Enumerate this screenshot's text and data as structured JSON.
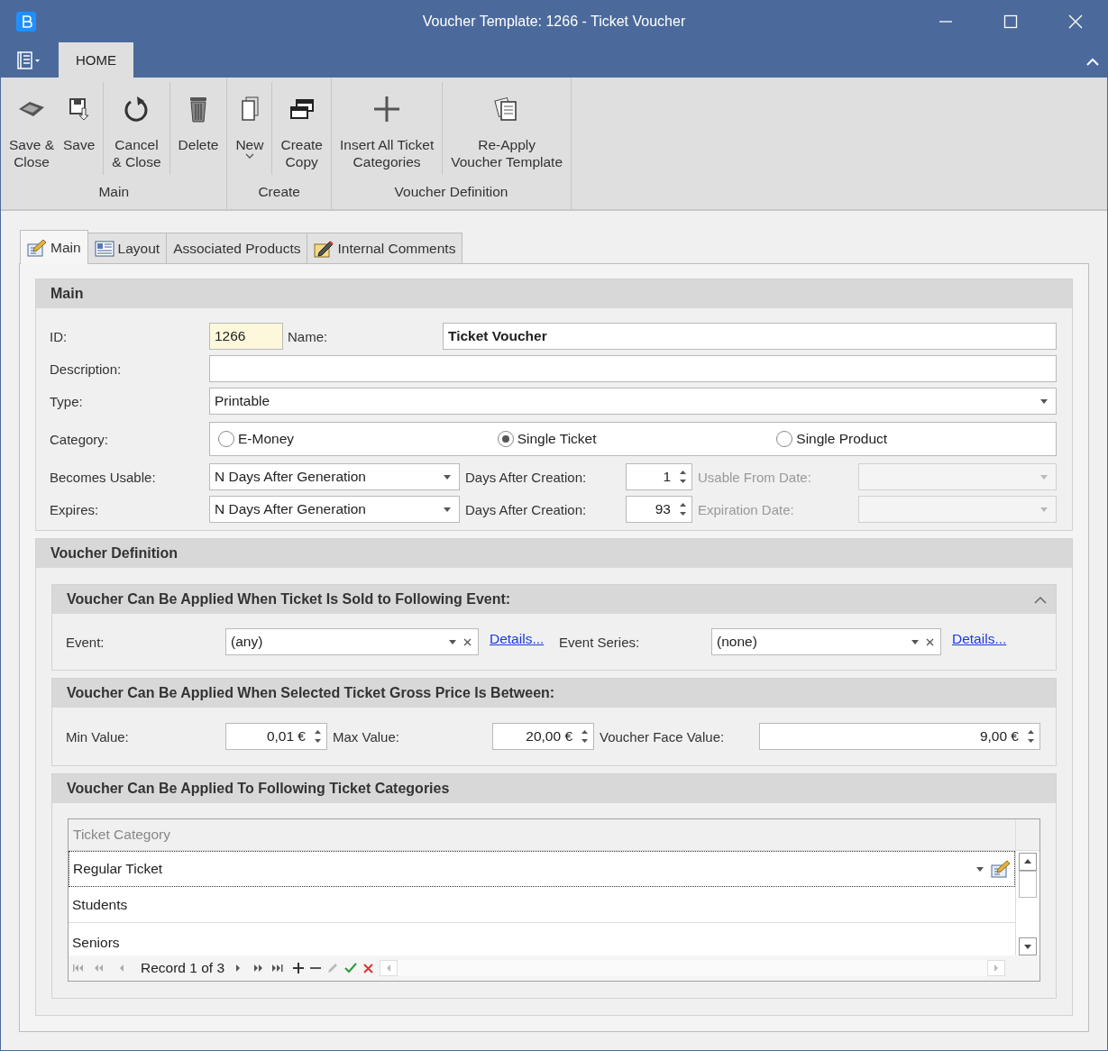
{
  "window": {
    "title": "Voucher Template: 1266 - Ticket Voucher"
  },
  "ribbon": {
    "tabs": [
      {
        "label": "HOME",
        "selected": true
      }
    ],
    "groups": [
      {
        "label": "Main",
        "clusters": [
          [
            {
              "label": "Save &\nClose",
              "kind": "save-close"
            },
            {
              "label": "Save",
              "kind": "save"
            }
          ],
          [
            {
              "label": "Cancel\n& Close",
              "kind": "cancel"
            }
          ],
          [
            {
              "label": "Delete",
              "kind": "delete"
            }
          ]
        ]
      },
      {
        "label": "Create",
        "clusters": [
          [
            {
              "label": "New",
              "kind": "new",
              "dropdown": true
            }
          ],
          [
            {
              "label": "Create\nCopy",
              "kind": "copy"
            }
          ]
        ]
      },
      {
        "label": "Voucher Definition",
        "clusters": [
          [
            {
              "label": "Insert All Ticket\nCategories",
              "kind": "insert"
            }
          ],
          [
            {
              "label": "Re-Apply\nVoucher Template",
              "kind": "reapply"
            }
          ]
        ]
      }
    ]
  },
  "form_tabs": [
    {
      "label": "Main",
      "kind": "main",
      "selected": true
    },
    {
      "label": "Layout",
      "kind": "layout",
      "selected": false
    },
    {
      "label": "Associated Products",
      "kind": "products",
      "selected": false
    },
    {
      "label": "Internal Comments",
      "kind": "comments",
      "selected": false
    }
  ],
  "main": {
    "title": "Main",
    "id_label": "ID:",
    "id": "1266",
    "name_label": "Name:",
    "name": "Ticket Voucher",
    "description_label": "Description:",
    "type_label": "Type:",
    "type": "Printable",
    "category_label": "Category:",
    "category_options": [
      {
        "label": "E-Money",
        "selected": false
      },
      {
        "label": "Single Ticket",
        "selected": true
      },
      {
        "label": "Single Product",
        "selected": false
      }
    ],
    "date_rows": [
      {
        "label": "Becomes Usable:",
        "mode": "N Days After Generation",
        "days_label": "Days After Creation:",
        "days": "1",
        "date_label": "Usable From Date:",
        "date_disabled": true
      },
      {
        "label": "Expires:",
        "mode": "N Days After Generation",
        "days_label": "Days After Creation:",
        "days": "93",
        "date_label": "Expiration Date:",
        "date_disabled": true
      }
    ]
  },
  "voucher_definition": {
    "title": "Voucher Definition",
    "event_section": {
      "title": "Voucher Can Be Applied When Ticket Is Sold to Following Event:",
      "expanded": true,
      "event_label": "Event:",
      "event": "(any)",
      "event_link": "Details...",
      "series_label": "Event Series:",
      "series": "(none)",
      "series_link": "Details..."
    },
    "price_section": {
      "title": "Voucher Can Be Applied When Selected Ticket Gross Price Is Between:",
      "min_label": "Min Value:",
      "min": "0,01 €",
      "max_label": "Max Value:",
      "max": "20,00 €",
      "face_label": "Voucher Face Value:",
      "face": "9,00 €"
    },
    "categories_section": {
      "title": "Voucher Can Be Applied To Following Ticket Categories",
      "column": "Ticket Category",
      "rows": [
        {
          "value": "Regular Ticket",
          "selected": true
        },
        {
          "value": "Students",
          "selected": false
        },
        {
          "value": "Seniors",
          "selected": false
        }
      ],
      "record": "Record 1 of 3"
    }
  }
}
